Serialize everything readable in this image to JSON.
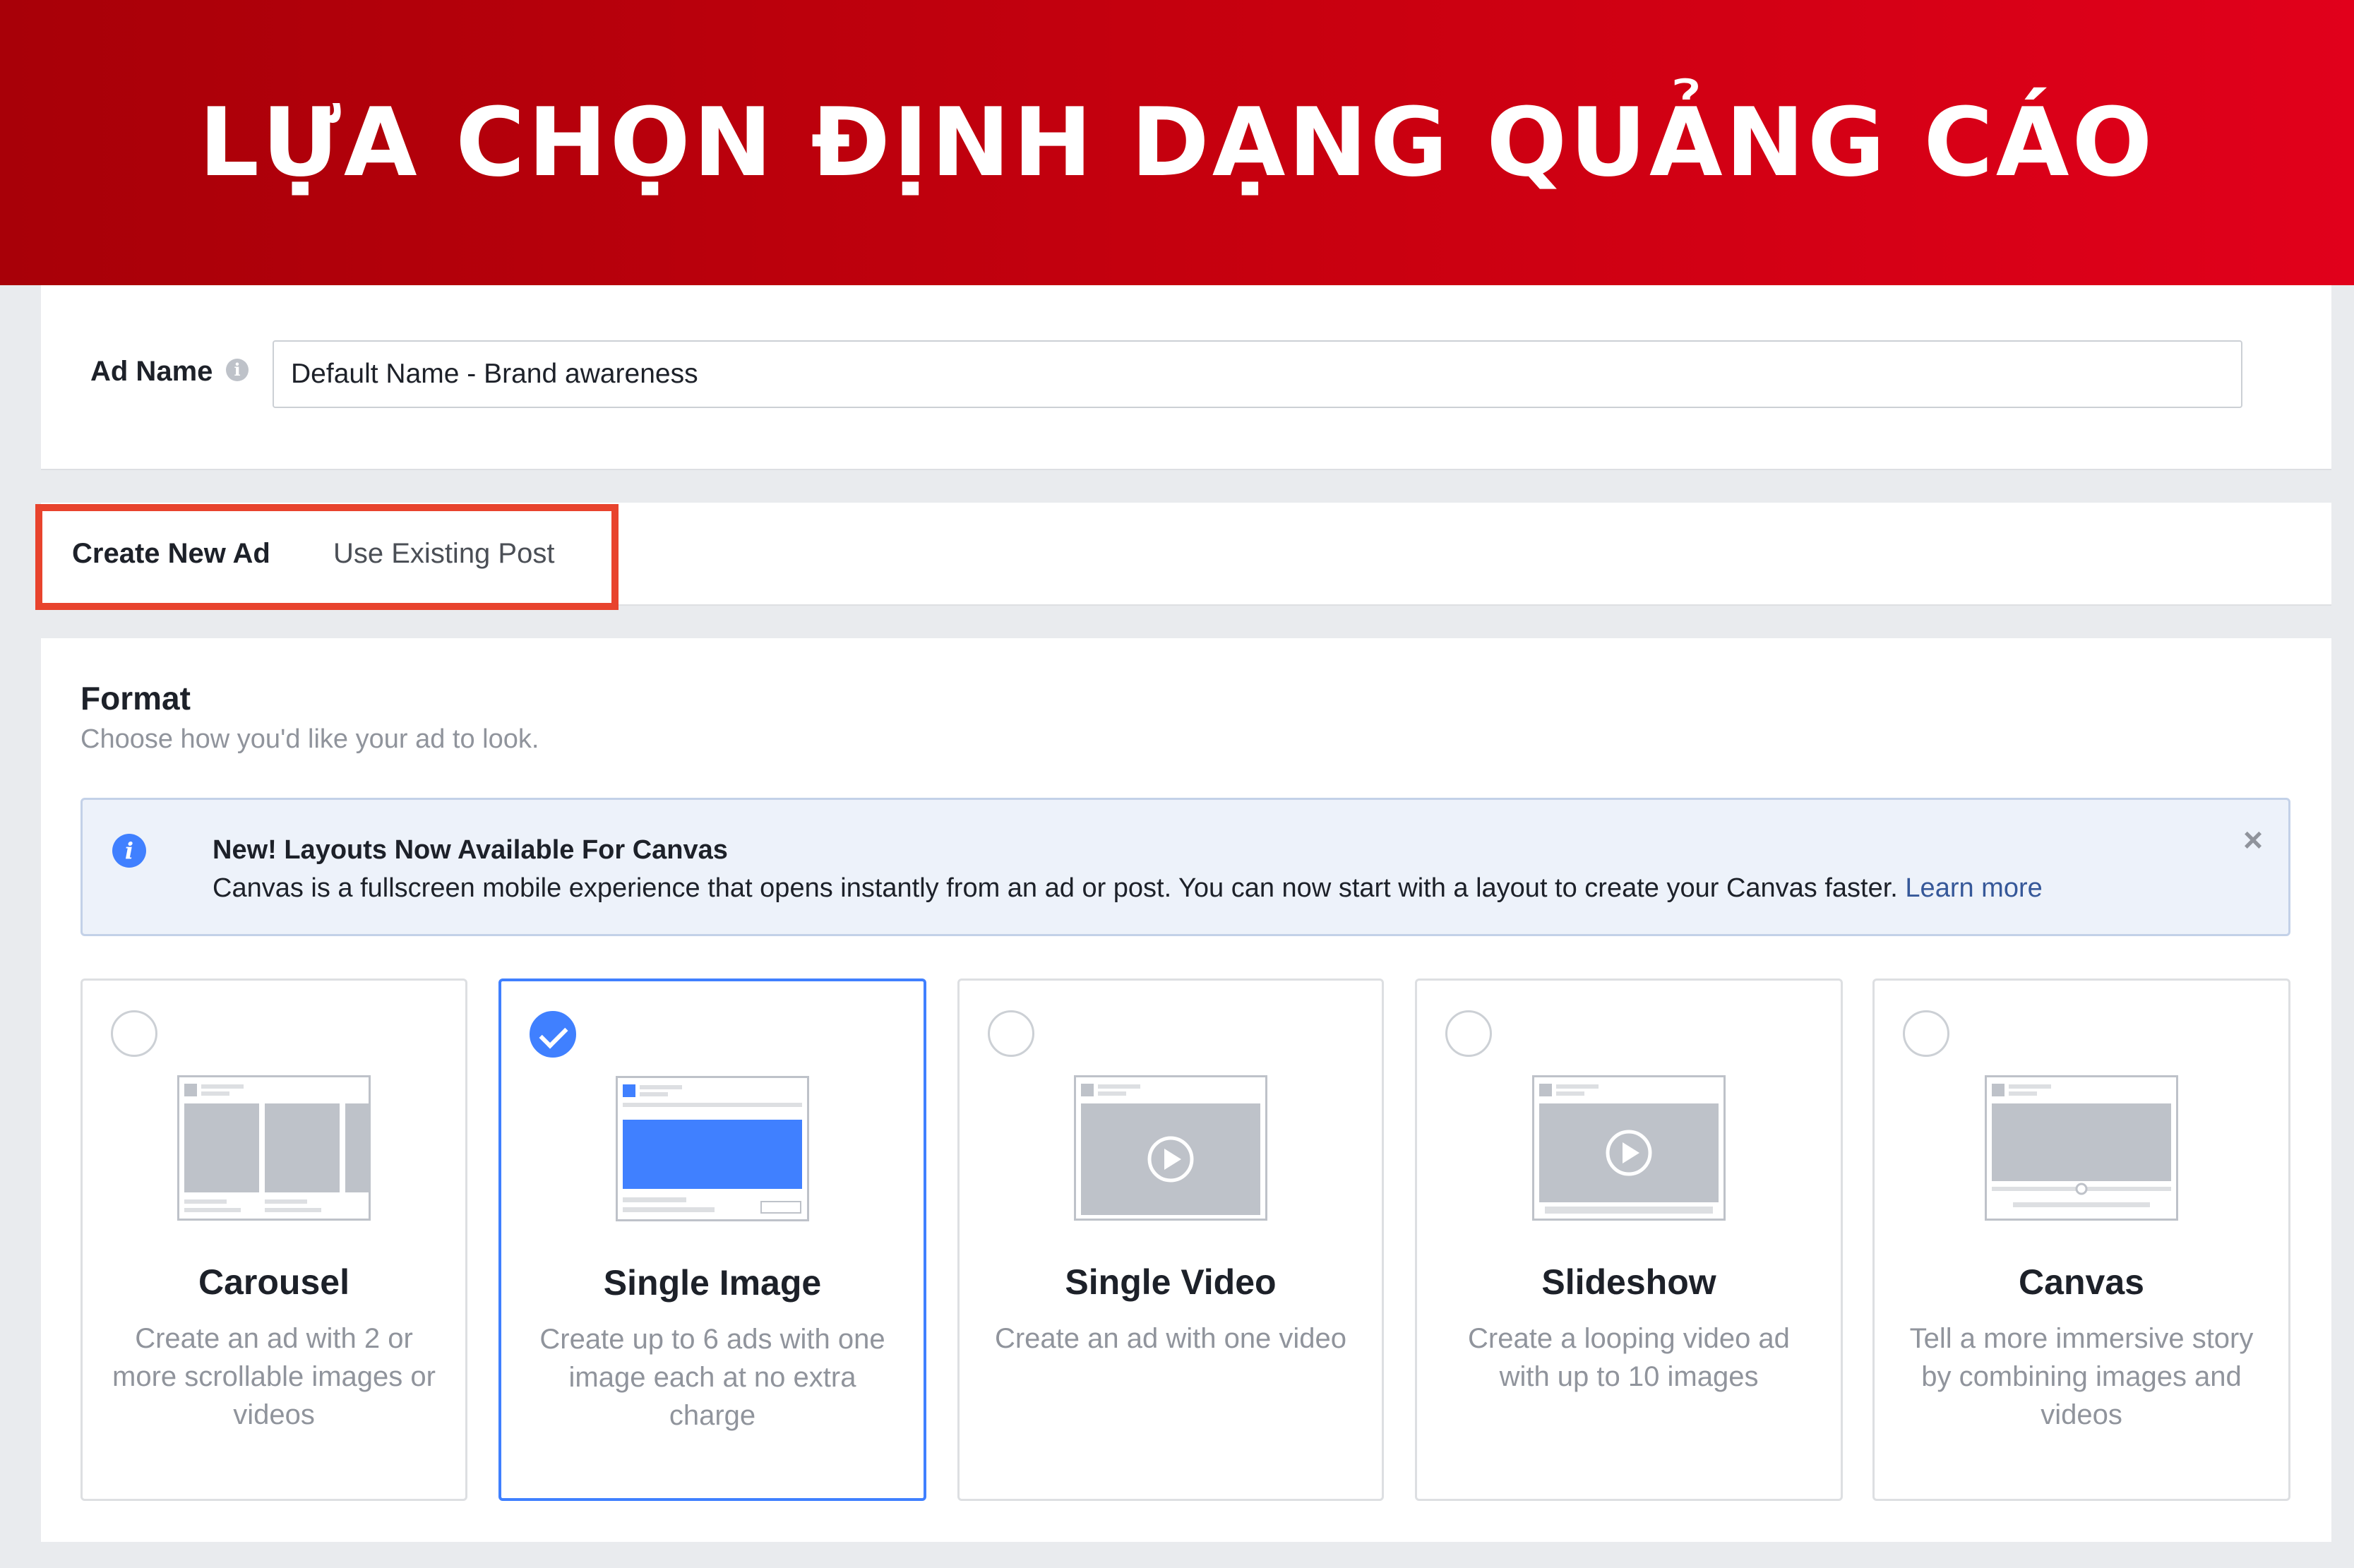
{
  "banner": {
    "title": "LỰA CHỌN ĐỊNH DẠNG QUẢNG CÁO"
  },
  "ad_name": {
    "label": "Ad Name",
    "info_icon": "i",
    "value": "Default Name - Brand awareness"
  },
  "tabs": {
    "create_new": "Create New Ad",
    "use_existing": "Use Existing Post",
    "highlight_color": "#e8432d"
  },
  "format": {
    "title": "Format",
    "subtitle": "Choose how you'd like your ad to look.",
    "notice": {
      "icon": "info-icon",
      "title": "New! Layouts Now Available For Canvas",
      "body": "Canvas is a fullscreen mobile experience that opens instantly from an ad or post. You can now start with a layout to create your Canvas faster.",
      "link": "Learn more",
      "close": "×"
    },
    "options": [
      {
        "title": "Carousel",
        "description": "Create an ad with 2 or more scrollable images or videos",
        "selected": false
      },
      {
        "title": "Single Image",
        "description": "Create up to 6 ads with one image each at no extra charge",
        "selected": true
      },
      {
        "title": "Single Video",
        "description": "Create an ad with one video",
        "selected": false
      },
      {
        "title": "Slideshow",
        "description": "Create a looping video ad with up to 10 images",
        "selected": false
      },
      {
        "title": "Canvas",
        "description": "Tell a more immersive story by combining images and videos",
        "selected": false
      }
    ]
  },
  "colors": {
    "accent": "#4080ff",
    "link": "#365899",
    "banner": "#c8000f"
  }
}
